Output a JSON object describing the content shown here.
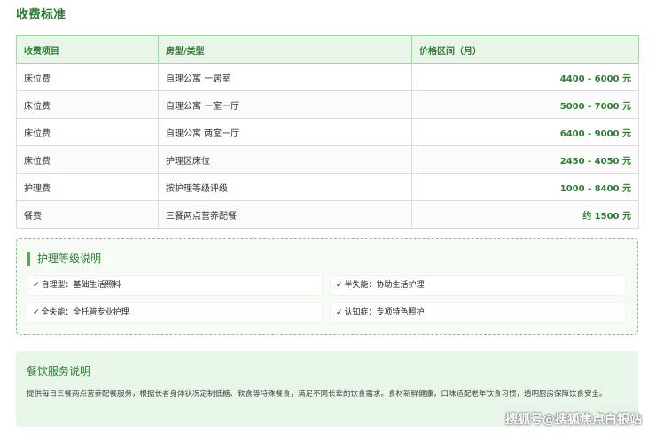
{
  "page": {
    "title": "收费标准"
  },
  "fees": {
    "headers": [
      "收费项目",
      "房型/类型",
      "价格区间（月）"
    ],
    "rows": [
      [
        "床位费",
        "自理公寓 一居室",
        "4400 - 6000 元"
      ],
      [
        "床位费",
        "自理公寓 一室一厅",
        "5000 - 7000 元"
      ],
      [
        "床位费",
        "自理公寓 两室一厅",
        "6400 - 9000 元"
      ],
      [
        "床位费",
        "护理区床位",
        "2450 - 4050 元"
      ],
      [
        "护理费",
        "按护理等级评级",
        "1000 - 8400 元"
      ],
      [
        "餐费",
        "三餐两点营养配餐",
        "约 1500 元"
      ]
    ]
  },
  "care": {
    "title": "护理等级说明",
    "check": "✓",
    "items": [
      "自理型：基础生活照料",
      "半失能：协助生活护理",
      "全失能：全托管专业护理",
      "认知症：专项特色照护"
    ]
  },
  "food": {
    "title": "餐饮服务说明",
    "desc": "提供每日三餐两点营养配餐服务，根据长者身体状况定制低糖、软食等特殊餐食，满足不同长辈的饮食需求。食材新鲜健康，口味适配老年饮食习惯，透明厨房保障饮食安全。"
  },
  "watermark": "搜狐号@搜狐焦点白银站",
  "colors": {
    "accent": "#2e7d32",
    "header_bg": "#e8f5e9",
    "bar": "#4caf50"
  }
}
